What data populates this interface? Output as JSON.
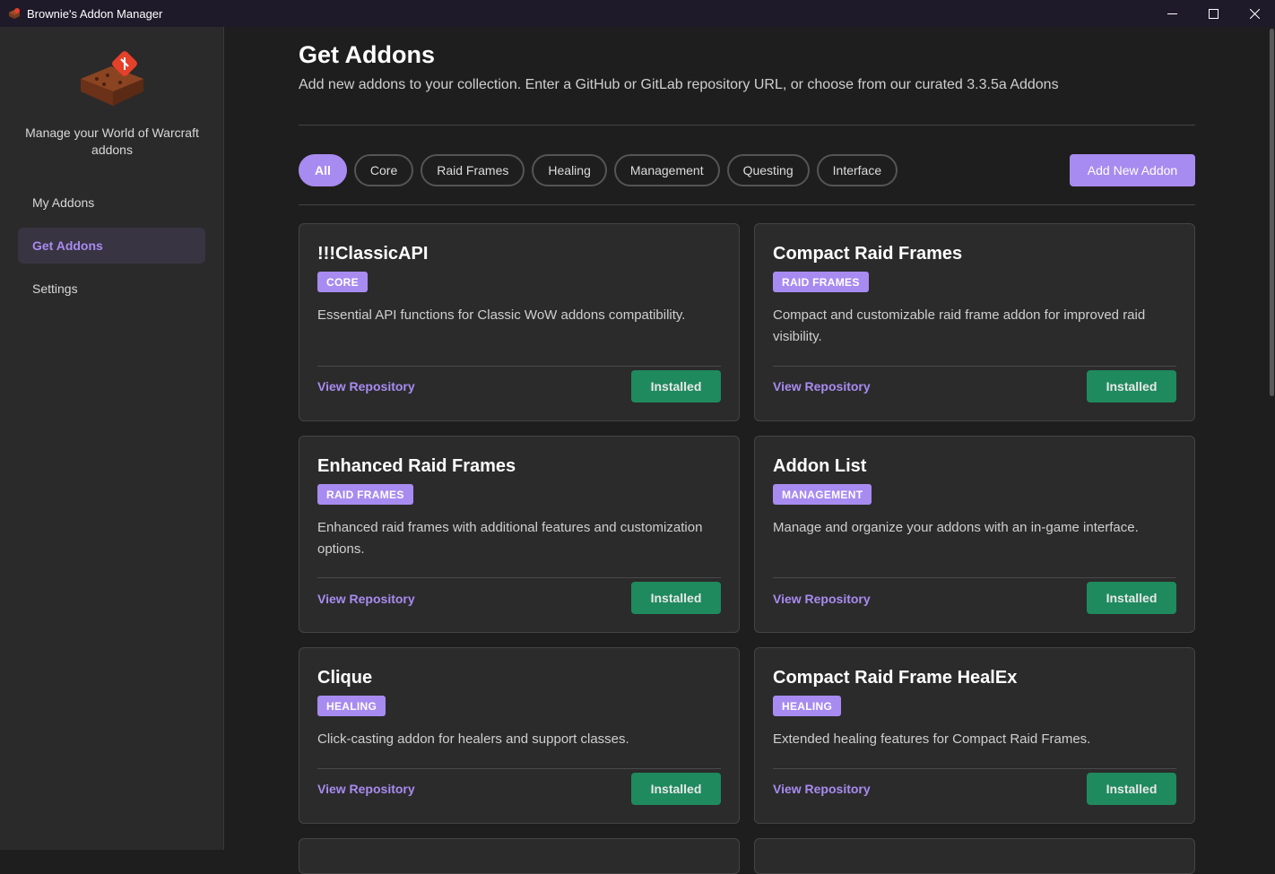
{
  "window": {
    "title": "Brownie's Addon Manager",
    "icon": "brownie-icon",
    "controls": [
      "minimize-icon",
      "maximize-icon",
      "close-icon"
    ]
  },
  "sidebar": {
    "logo": "brownie-logo",
    "tagline": "Manage your World of Warcraft addons",
    "items": [
      {
        "label": "My Addons",
        "active": false
      },
      {
        "label": "Get Addons",
        "active": true
      },
      {
        "label": "Settings",
        "active": false
      }
    ]
  },
  "main": {
    "title": "Get Addons",
    "subtitle": "Add new addons to your collection. Enter a GitHub or GitLab repository URL, or choose from our curated 3.3.5a Addons",
    "filters": [
      {
        "label": "All",
        "active": true
      },
      {
        "label": "Core",
        "active": false
      },
      {
        "label": "Raid Frames",
        "active": false
      },
      {
        "label": "Healing",
        "active": false
      },
      {
        "label": "Management",
        "active": false
      },
      {
        "label": "Questing",
        "active": false
      },
      {
        "label": "Interface",
        "active": false
      }
    ],
    "add_button": "Add New Addon",
    "addons": [
      {
        "name": "!!!ClassicAPI",
        "tag": "CORE",
        "description": "Essential API functions for Classic WoW addons compatibility.",
        "link": "View Repository",
        "status": "Installed"
      },
      {
        "name": "Compact Raid Frames",
        "tag": "RAID FRAMES",
        "description": "Compact and customizable raid frame addon for improved raid visibility.",
        "link": "View Repository",
        "status": "Installed"
      },
      {
        "name": "Enhanced Raid Frames",
        "tag": "RAID FRAMES",
        "description": "Enhanced raid frames with additional features and customization options.",
        "link": "View Repository",
        "status": "Installed"
      },
      {
        "name": "Addon List",
        "tag": "MANAGEMENT",
        "description": "Manage and organize your addons with an in-game interface.",
        "link": "View Repository",
        "status": "Installed"
      },
      {
        "name": "Clique",
        "tag": "HEALING",
        "description": "Click-casting addon for healers and support classes.",
        "link": "View Repository",
        "status": "Installed"
      },
      {
        "name": "Compact Raid Frame HealEx",
        "tag": "HEALING",
        "description": "Extended healing features for Compact Raid Frames.",
        "link": "View Repository",
        "status": "Installed"
      }
    ]
  },
  "colors": {
    "accent": "#a88bf0",
    "installed": "#1f8a5e",
    "background": "#1e1e1e",
    "sidebar": "#2a2a2a",
    "card": "#2b2b2b"
  }
}
